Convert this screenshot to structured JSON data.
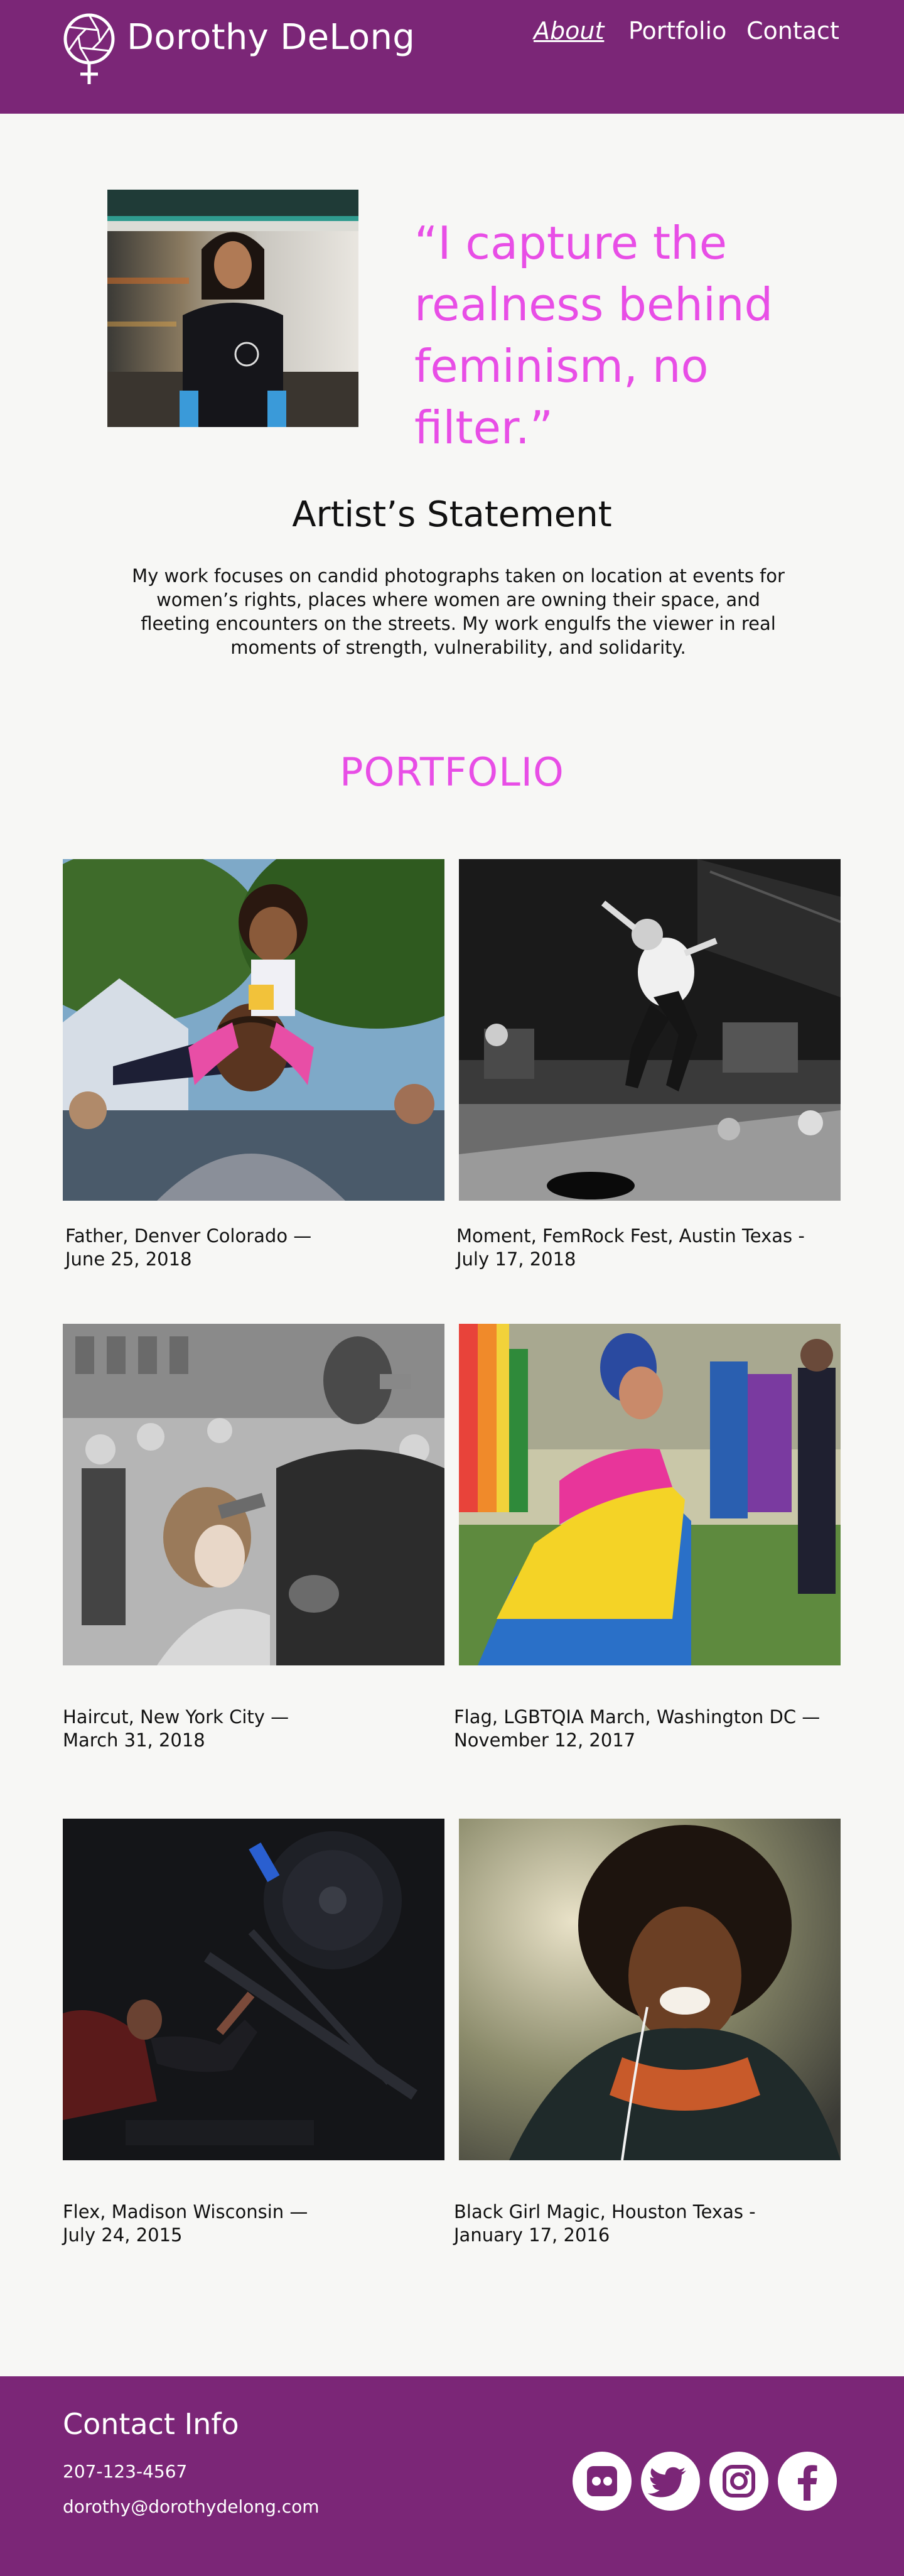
{
  "header": {
    "brand": "Dorothy DeLong",
    "logo_icon": "feminine-aperture-icon",
    "nav": {
      "about": "About",
      "portfolio": "Portfolio",
      "contact": "Contact"
    },
    "background": "#7b2677"
  },
  "hero": {
    "quote": "“I capture the realness behind feminism, no filter.”",
    "quote_color": "#e84ee6"
  },
  "statement": {
    "title": "Artist’s Statement",
    "body": "My work focuses on candid photographs taken on location at events for women’s rights, places where women are owning their space, and fleeting encounters on the streets. My work engulfs the viewer in real moments of strength, vulnerability, and solidarity."
  },
  "portfolio": {
    "title": "PORTFOLIO",
    "items": [
      {
        "line1": "Father, Denver Colorado —",
        "line2": "June 25, 2018"
      },
      {
        "line1": "Moment, FemRock Fest, Austin Texas -",
        "line2": "July 17, 2018"
      },
      {
        "line1": "Haircut, New York City —",
        "line2": "March 31, 2018"
      },
      {
        "line1": "Flag, LGBTQIA March, Washington DC —",
        "line2": "November 12, 2017"
      },
      {
        "line1": "Flex, Madison Wisconsin —",
        "line2": "July 24, 2015"
      },
      {
        "line1": "Black Girl Magic, Houston Texas -",
        "line2": "January 17, 2016"
      }
    ]
  },
  "footer": {
    "title": "Contact Info",
    "phone": "207-123-4567",
    "email": "dorothy@dorothydelong.com",
    "social_icons": [
      "flickr-icon",
      "twitter-icon",
      "instagram-icon",
      "facebook-icon"
    ],
    "icon_color": "#7b2677"
  }
}
